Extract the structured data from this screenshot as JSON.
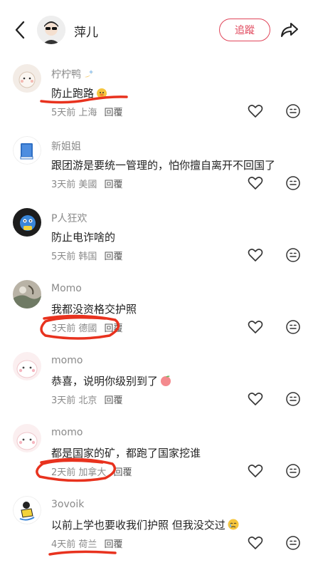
{
  "header": {
    "title": "萍儿",
    "follow_label": "追蹤"
  },
  "comments": [
    {
      "user": "柠柠鸭",
      "text": "防止跑路",
      "time": "5天前",
      "location": "上海",
      "reply": "回覆"
    },
    {
      "user": "新姐姐",
      "text": "跟团游是要统一管理的，怕你擅自离开不回国了",
      "time": "3天前",
      "location": "美國",
      "reply": "回覆"
    },
    {
      "user": "P人狂欢",
      "text": "防止电诈啥的",
      "time": "5天前",
      "location": "韩国",
      "reply": "回覆"
    },
    {
      "user": "Momo",
      "text": "我都没资格交护照",
      "time": "3天前",
      "location": "德國",
      "reply": "回覆"
    },
    {
      "user": "momo",
      "text": "恭喜，说明你级别到了",
      "time": "3天前",
      "location": "北京",
      "reply": "回覆"
    },
    {
      "user": "momo",
      "text": "都是国家的矿，都跑了国家挖谁",
      "time": "2天前",
      "location": "加拿大",
      "reply": "回覆"
    },
    {
      "user": "3ovoik",
      "text": "以前上学也要收我们护照 但我没交过",
      "time": "4天前",
      "location": "荷兰",
      "reply": "回覆"
    }
  ],
  "colors": {
    "accent": "#e0455a",
    "annotation": "#e8321e"
  }
}
